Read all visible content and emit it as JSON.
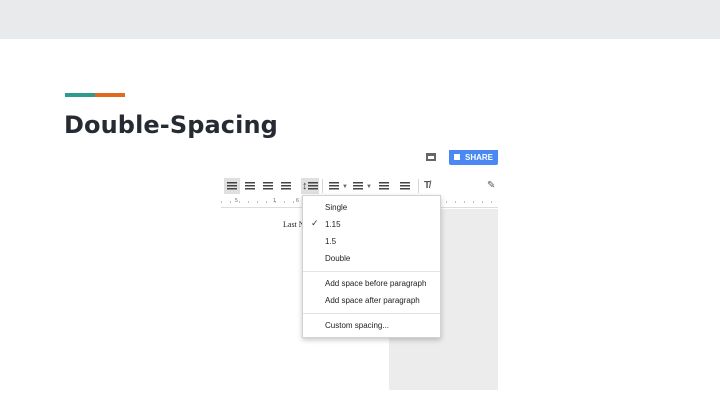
{
  "slide": {
    "title": "Double-Spacing",
    "colors": {
      "band": "#e9eaec",
      "accent_teal": "#2f9a8f",
      "accent_orange": "#e06a1e"
    }
  },
  "docs": {
    "share_label": "SHARE",
    "doc_text": "Last N",
    "ruler": {
      "left_num": "5",
      "mid_num": "1",
      "right_num": "6"
    },
    "icons": [
      "comment-icon",
      "lock-icon",
      "align-left-icon",
      "align-center-icon",
      "align-right-icon",
      "align-justify-icon",
      "line-spacing-icon",
      "numbered-list-icon",
      "bulleted-list-icon",
      "decrease-indent-icon",
      "increase-indent-icon",
      "clear-formatting-icon",
      "pencil-icon"
    ],
    "line_spacing_menu": {
      "options": [
        "Single",
        "1.15",
        "1.5",
        "Double"
      ],
      "selected": "1.15",
      "paragraph_actions": [
        "Add space before paragraph",
        "Add space after paragraph"
      ],
      "custom": "Custom spacing..."
    }
  }
}
